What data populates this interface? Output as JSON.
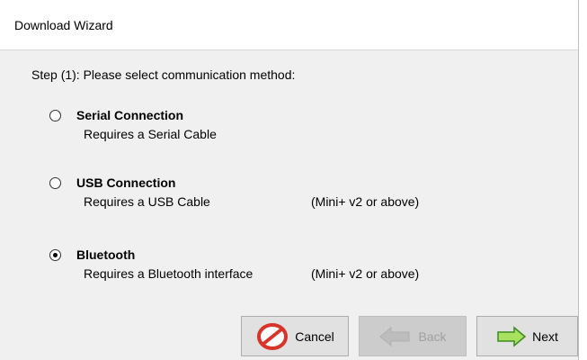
{
  "window": {
    "title": "Download Wizard"
  },
  "step": {
    "text": "Step (1): Please select communication method:"
  },
  "options": [
    {
      "label": "Serial Connection",
      "description": "Requires a Serial Cable",
      "note": "",
      "selected": false
    },
    {
      "label": "USB Connection",
      "description": "Requires a USB Cable",
      "note": "(Mini+ v2 or above)",
      "selected": false
    },
    {
      "label": "Bluetooth",
      "description": "Requires a Bluetooth interface",
      "note": "(Mini+ v2 or above)",
      "selected": true
    }
  ],
  "buttons": {
    "cancel": {
      "label": "Cancel",
      "icon": "cancel-icon",
      "enabled": true
    },
    "back": {
      "label": "Back",
      "icon": "back-arrow-icon",
      "enabled": false
    },
    "next": {
      "label": "Next",
      "icon": "next-arrow-icon",
      "enabled": true
    }
  },
  "colors": {
    "cancel_icon": "#d9342b",
    "next_arrow_fill": "#a8e060",
    "next_arrow_stroke": "#3c8c1e",
    "back_arrow_fill": "#bdbdbd"
  }
}
